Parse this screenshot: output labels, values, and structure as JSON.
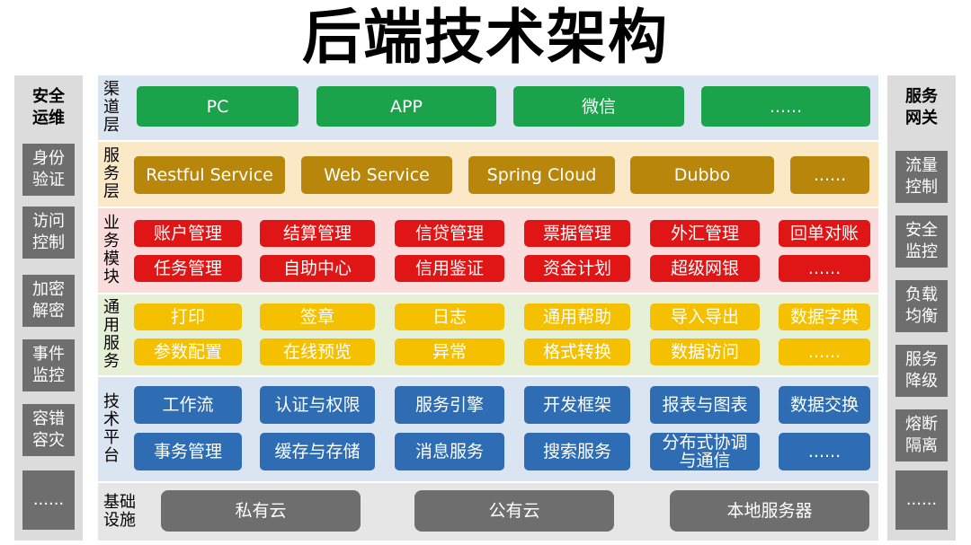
{
  "title": "后端技术架构",
  "left_column": {
    "header": "安全运维",
    "items": [
      "身份验证",
      "访问控制",
      "加密解密",
      "事件监控",
      "容错容灾",
      "......"
    ]
  },
  "right_column": {
    "header": "服务网关",
    "items": [
      "流量控制",
      "安全监控",
      "负载均衡",
      "服务降级",
      "熔断隔离",
      "......"
    ]
  },
  "layers": {
    "channel": {
      "label": "渠道层",
      "items": [
        "PC",
        "APP",
        "微信",
        "......"
      ],
      "color": "#1aa34a",
      "bg": "#dbe5f1"
    },
    "service": {
      "label": "服务层",
      "items": [
        "Restful Service",
        "Web Service",
        "Spring Cloud",
        "Dubbo",
        "......"
      ],
      "color": "#b8860b",
      "bg": "#fbe8c6"
    },
    "business": {
      "label": "业务模块",
      "row1": [
        "账户管理",
        "结算管理",
        "信贷管理",
        "票据管理",
        "外汇管理",
        "回单对账"
      ],
      "row2": [
        "任务管理",
        "自助中心",
        "信用鉴证",
        "资金计划",
        "超级网银",
        "......"
      ],
      "color": "#e01515",
      "bg": "#fbdcdc"
    },
    "common": {
      "label": "通用服务",
      "row1": [
        "打印",
        "签章",
        "日志",
        "通用帮助",
        "导入导出",
        "数据字典"
      ],
      "row2": [
        "参数配置",
        "在线预览",
        "异常",
        "格式转换",
        "数据访问",
        "......"
      ],
      "color": "#f5c000",
      "bg": "#e6f0d6"
    },
    "tech": {
      "label": "技术平台",
      "row1": [
        "工作流",
        "认证与权限",
        "服务引擎",
        "开发框架",
        "报表与图表",
        "数据交换"
      ],
      "row2": [
        "事务管理",
        "缓存与存储",
        "消息服务",
        "搜索服务",
        "分布式协调与通信",
        "......"
      ],
      "color": "#2e6db4",
      "bg": "#dbe5f1"
    },
    "infra": {
      "label": "基础设施",
      "items": [
        "私有云",
        "公有云",
        "本地服务器"
      ],
      "color": "#6e6e6e",
      "bg": "#e6e6e6"
    }
  }
}
